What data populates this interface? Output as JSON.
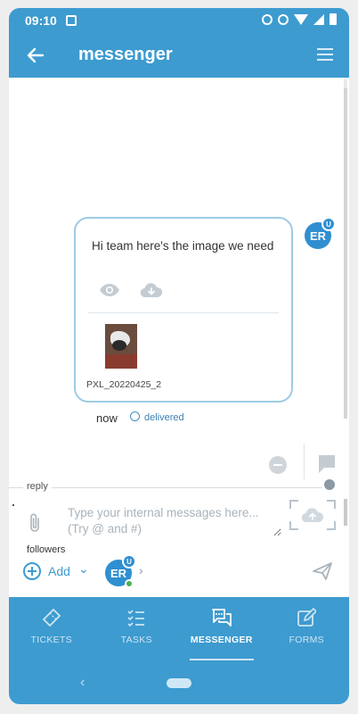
{
  "status": {
    "time": "09:10"
  },
  "app": {
    "title": "messenger"
  },
  "message": {
    "text": "Hi team here's the image we need",
    "attachment_name": "PXL_20220425_2",
    "time": "now",
    "status": "delivered",
    "sender_initials": "ER",
    "sender_badge": "U"
  },
  "reply": {
    "label": "reply",
    "placeholder": "Type your internal messages here...\n(Try @ and #)",
    "value": ""
  },
  "followers": {
    "label": "followers",
    "add_label": "Add",
    "avatar_initials": "ER",
    "avatar_badge": "U"
  },
  "nav": {
    "items": [
      {
        "label": "TICKETS",
        "icon": "ticket-icon"
      },
      {
        "label": "TASKS",
        "icon": "tasks-icon"
      },
      {
        "label": "MESSENGER",
        "icon": "messenger-icon",
        "active": true
      },
      {
        "label": "FORMS",
        "icon": "forms-icon"
      }
    ]
  },
  "colors": {
    "primary": "#3d9bd0",
    "bubble_border": "#9fcbe4",
    "link": "#3d9bd0"
  }
}
